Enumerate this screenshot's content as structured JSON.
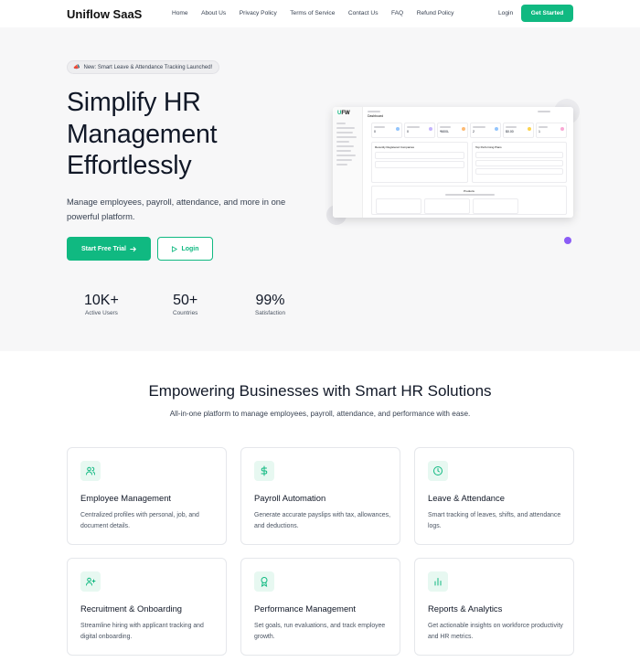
{
  "nav": {
    "brand": "Uniflow SaaS",
    "links": [
      "Home",
      "About Us",
      "Privacy Policy",
      "Terms of Service",
      "Contact Us",
      "FAQ",
      "Refund Policy"
    ],
    "login": "Login",
    "cta": "Get Started"
  },
  "hero": {
    "badge": "New: Smart Leave & Attendance Tracking Launched!",
    "title_line1": "Simplify HR",
    "title_line2": "Management",
    "title_line3": "Effortlessly",
    "subtitle": "Manage employees, payroll, attendance, and more in one powerful platform.",
    "primary_button": "Start Free Trial",
    "secondary_button": "Login",
    "stats": [
      {
        "value": "10K+",
        "label": "Active Users"
      },
      {
        "value": "50+",
        "label": "Countries"
      },
      {
        "value": "99%",
        "label": "Satisfaction"
      }
    ]
  },
  "mock": {
    "logo_u": "U",
    "logo_rest": "FW",
    "heading": "Dashboard",
    "panel_left": "Recently Registered Companies",
    "panel_right": "Top Performing Plans",
    "panel_bottom": "Products",
    "stat_values": [
      "0",
      "0",
      "₹600L",
      "2",
      "$0.00",
      "1"
    ]
  },
  "features": {
    "title": "Empowering Businesses with Smart HR Solutions",
    "subtitle": "All-in-one platform to manage employees, payroll, attendance, and performance with ease.",
    "cards": [
      {
        "icon": "users-icon",
        "title": "Employee Management",
        "desc": "Centralized profiles with personal, job, and document details."
      },
      {
        "icon": "dollar-icon",
        "title": "Payroll Automation",
        "desc": "Generate accurate payslips with tax, allowances, and deductions."
      },
      {
        "icon": "clock-icon",
        "title": "Leave & Attendance",
        "desc": "Smart tracking of leaves, shifts, and attendance logs."
      },
      {
        "icon": "user-plus-icon",
        "title": "Recruitment & Onboarding",
        "desc": "Streamline hiring with applicant tracking and digital onboarding."
      },
      {
        "icon": "award-icon",
        "title": "Performance Management",
        "desc": "Set goals, run evaluations, and track employee growth."
      },
      {
        "icon": "bar-chart-icon",
        "title": "Reports & Analytics",
        "desc": "Get actionable insights on workforce productivity and HR metrics."
      }
    ]
  },
  "colors": {
    "accent": "#10b981",
    "hero_bg": "#f7f7f8",
    "icon_bg": "#e7f8f1"
  }
}
